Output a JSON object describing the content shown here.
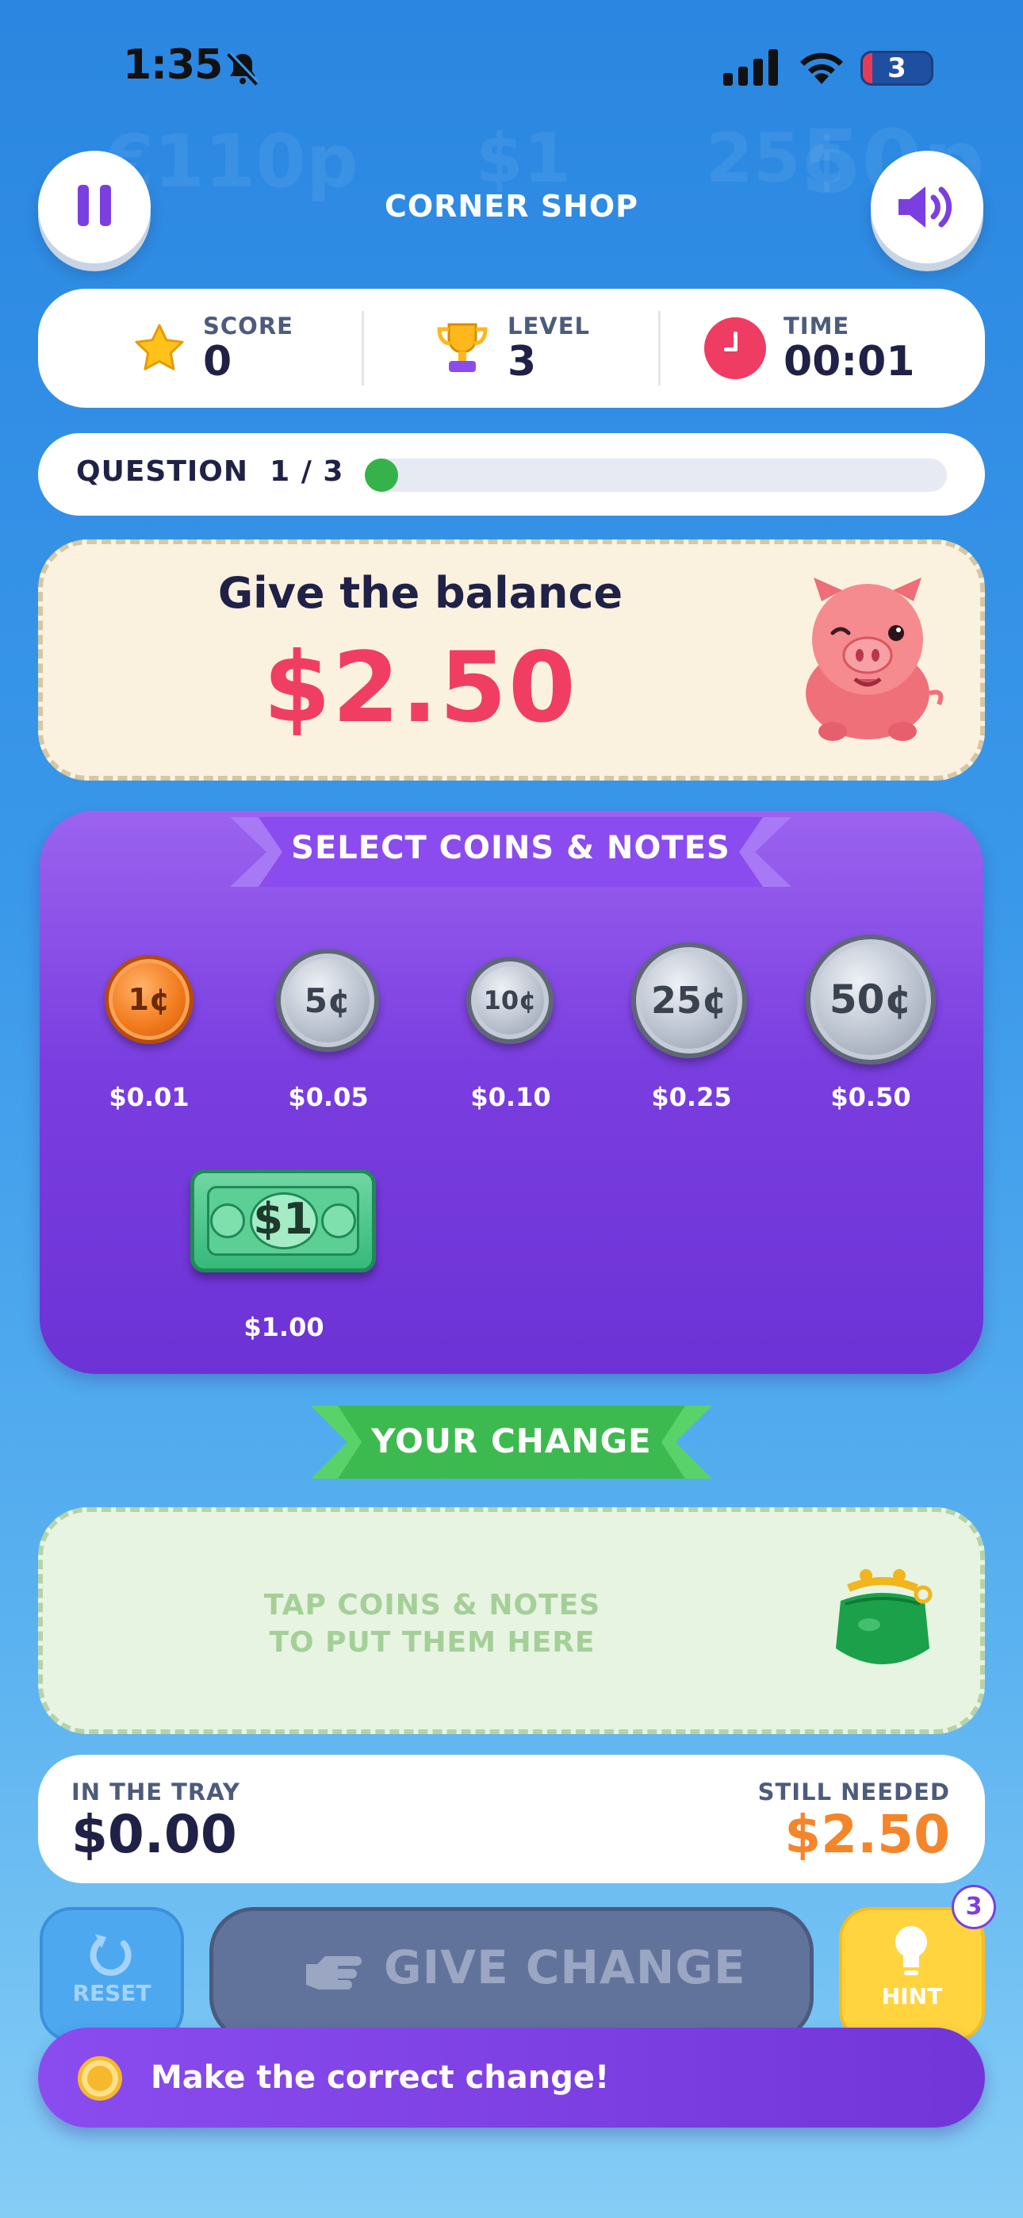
{
  "status_bar": {
    "time": "1:35",
    "battery": "3"
  },
  "header": {
    "title": "CORNER SHOP"
  },
  "stats": {
    "score_label": "SCORE",
    "score": "0",
    "level_label": "LEVEL",
    "level": "3",
    "time_label": "TIME",
    "time": "00:01"
  },
  "question": {
    "label": "QUESTION",
    "progress": "1 / 3",
    "progress_fraction": 0.0
  },
  "prompt": {
    "title": "Give the balance",
    "amount": "$2.50"
  },
  "select_panel": {
    "title": "SELECT COINS & NOTES",
    "coins": [
      {
        "face": "1¢",
        "value": "$0.01",
        "metal": "copper"
      },
      {
        "face": "5¢",
        "value": "$0.05",
        "metal": "silver"
      },
      {
        "face": "10¢",
        "value": "$0.10",
        "metal": "silver"
      },
      {
        "face": "25¢",
        "value": "$0.25",
        "metal": "silver"
      },
      {
        "face": "50¢",
        "value": "$0.50",
        "metal": "silver"
      }
    ],
    "notes": [
      {
        "face": "$1",
        "value": "$1.00"
      }
    ]
  },
  "change": {
    "title": "YOUR CHANGE",
    "hint_line1": "TAP COINS & NOTES",
    "hint_line2": "TO PUT THEM HERE"
  },
  "totals": {
    "tray_label": "IN THE TRAY",
    "tray_value": "$0.00",
    "needed_label": "STILL NEEDED",
    "needed_value": "$2.50"
  },
  "actions": {
    "reset": "RESET",
    "give": "GIVE CHANGE",
    "hint": "HINT",
    "hint_count": "3"
  },
  "toast": {
    "message": "Make the correct change!"
  },
  "colors": {
    "accent_purple": "#7b3fe0",
    "amount_red": "#ef3e62",
    "needed_orange": "#f5852a",
    "green": "#35b34a"
  }
}
